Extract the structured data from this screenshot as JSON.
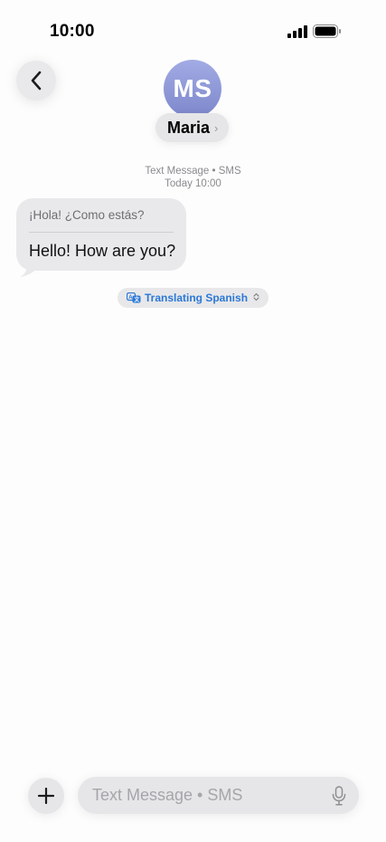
{
  "status_bar": {
    "time": "10:00",
    "signal_icon": "cellular-signal-icon",
    "battery_icon": "battery-full-icon"
  },
  "header": {
    "back_icon": "chevron-left-icon",
    "avatar_initials": "MS",
    "contact_name": "Maria",
    "contact_chevron": "›"
  },
  "thread": {
    "service_label": "Text Message • SMS",
    "timestamp": "Today 10:00",
    "messages": [
      {
        "direction": "incoming",
        "original": "¡Hola! ¿Como estás?",
        "translated": "Hello! How are you?"
      }
    ],
    "translation": {
      "label": "Translating Spanish",
      "icon": "translate-icon",
      "accent_color": "#2b78d6"
    }
  },
  "composer": {
    "add_icon": "plus-icon",
    "placeholder": "Text Message • SMS",
    "value": "",
    "mic_icon": "microphone-icon"
  },
  "colors": {
    "avatar_gradient_top": "#a2abe4",
    "avatar_gradient_bottom": "#7d88cb",
    "bubble_background": "#e9e9eb"
  }
}
